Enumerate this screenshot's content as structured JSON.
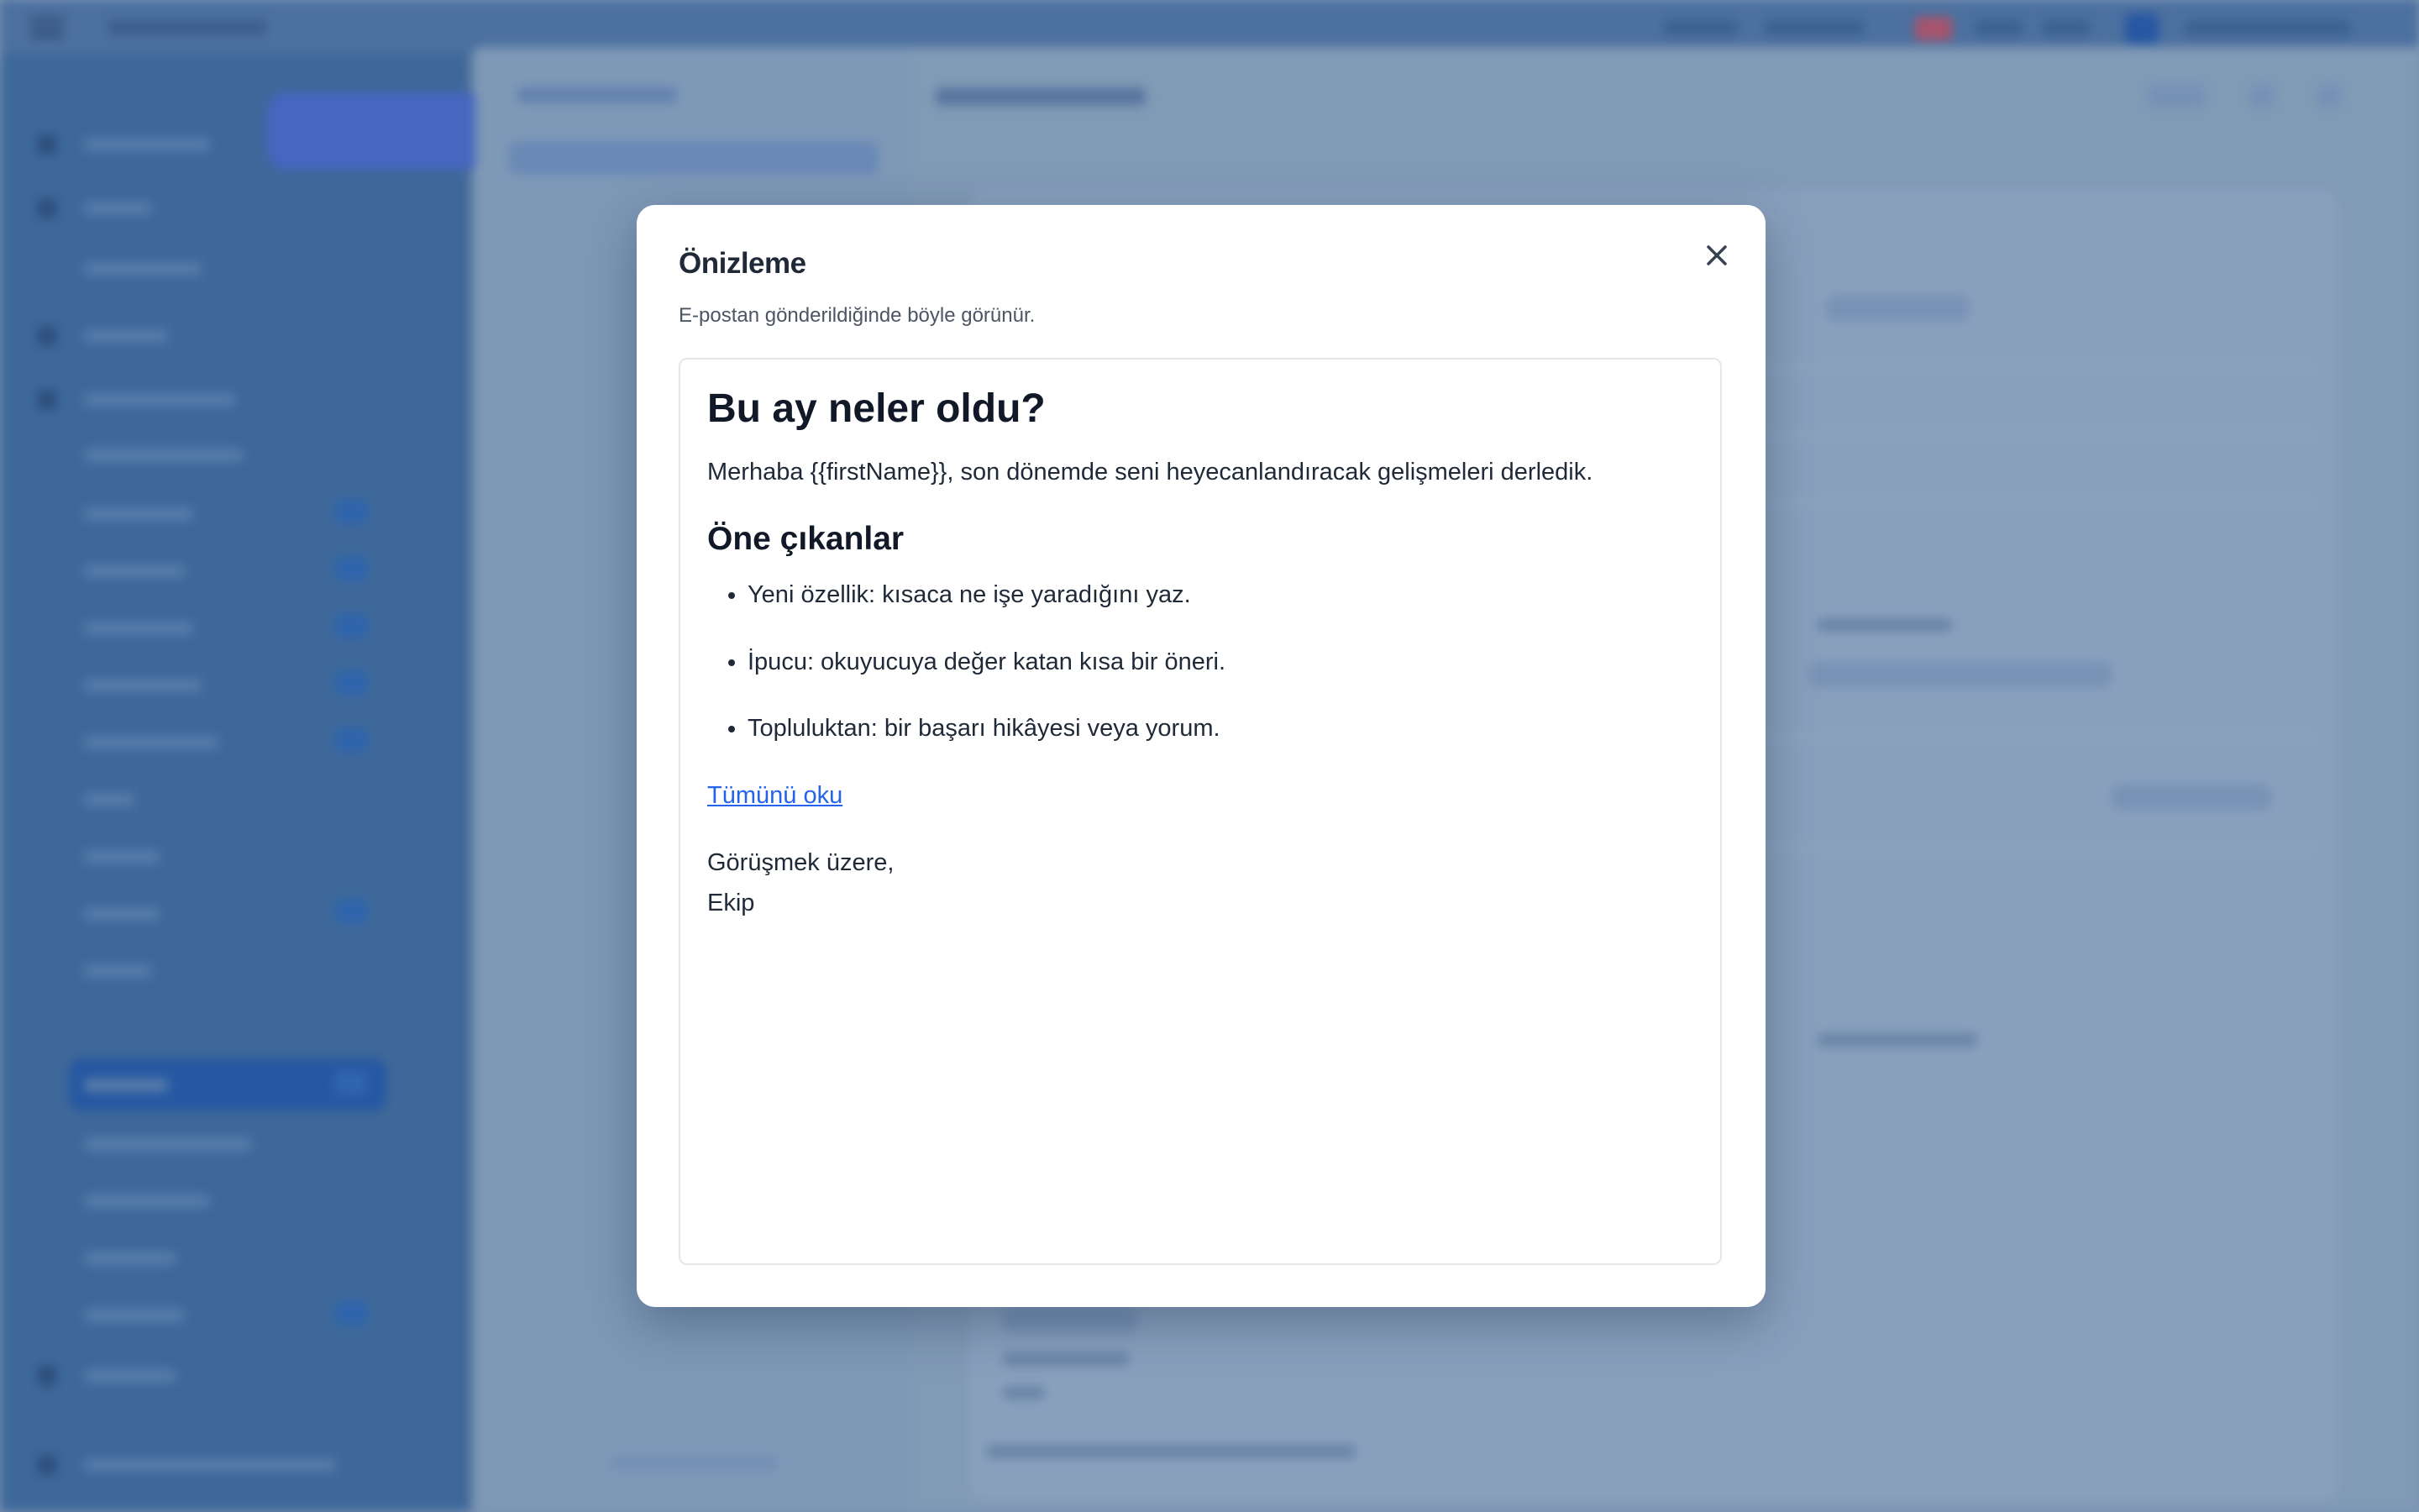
{
  "modal": {
    "title": "Önizleme",
    "subtitle": "E-postan gönderildiğinde böyle görünür.",
    "close_icon": "close-icon"
  },
  "email": {
    "heading": "Bu ay neler oldu?",
    "greeting": "Merhaba {{firstName}}, son dönemde seni heyecanlandıracak gelişmeleri derledik.",
    "section_heading": "Öne çıkanlar",
    "highlights": [
      "Yeni özellik: kısaca ne işe yaradığını yaz.",
      "İpucu: okuyucuya değer katan kısa bir öneri.",
      "Topluluktan: bir başarı hikâyesi veya yorum."
    ],
    "link_text": "Tümünü oku",
    "signoff_line1": "Görüşmek üzere,",
    "signoff_line2": "Ekip"
  },
  "colors": {
    "link": "#2563eb",
    "overlay_tint": "#7a93b2",
    "modal_bg": "#ffffff"
  }
}
